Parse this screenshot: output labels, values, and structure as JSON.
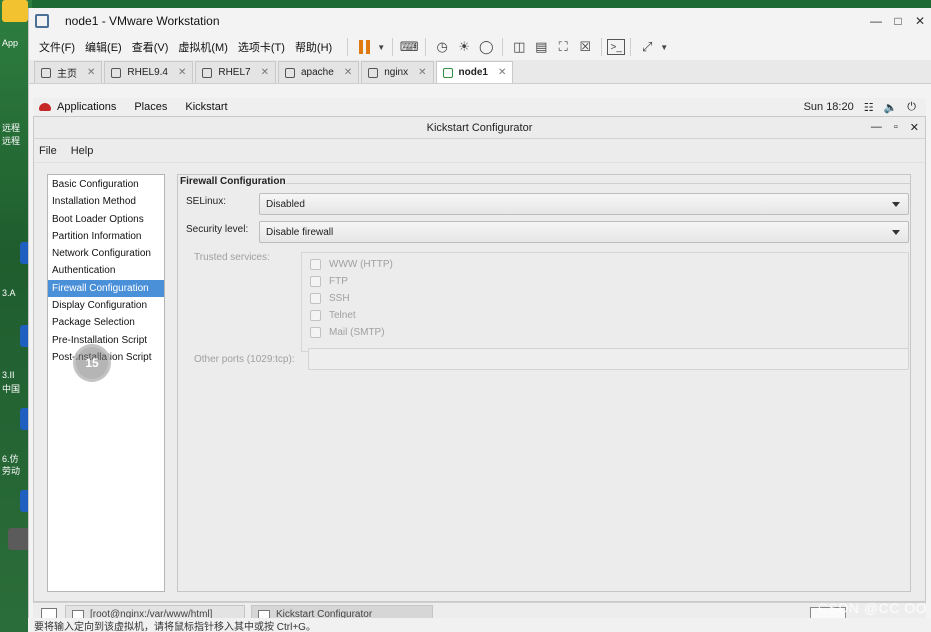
{
  "desktop": {
    "labels": [
      "App",
      "远程",
      "远程",
      "3.A",
      "3.II",
      "中国",
      "6.仿",
      "劳动"
    ]
  },
  "vmware": {
    "title": "node1 - VMware Workstation",
    "menu": [
      "文件(F)",
      "编辑(E)",
      "查看(V)",
      "虚拟机(M)",
      "选项卡(T)",
      "帮助(H)"
    ],
    "tabs": [
      {
        "label": "主页"
      },
      {
        "label": "RHEL9.4"
      },
      {
        "label": "RHEL7"
      },
      {
        "label": "apache"
      },
      {
        "label": "nginx"
      },
      {
        "label": "node1"
      }
    ],
    "status_text": "要将输入定向到该虚拟机，请将鼠标指针移入其中或按 Ctrl+G。"
  },
  "gnome": {
    "applications": "Applications",
    "places": "Places",
    "kickstart": "Kickstart",
    "clock": "Sun 18:20"
  },
  "kickstart": {
    "window_title": "Kickstart Configurator",
    "menu": [
      "File",
      "Help"
    ],
    "nav_items": [
      "Basic Configuration",
      "Installation Method",
      "Boot Loader Options",
      "Partition Information",
      "Network Configuration",
      "Authentication",
      "Firewall Configuration",
      "Display Configuration",
      "Package Selection",
      "Pre-Installation Script",
      "Post-Installation Script"
    ],
    "selected_nav": "Firewall Configuration",
    "panel_title": "Firewall Configuration",
    "selinux_label": "SELinux:",
    "selinux_value": "Disabled",
    "security_label": "Security level:",
    "security_value": "Disable firewall",
    "trusted_label": "Trusted services:",
    "trusted_services": [
      "WWW (HTTP)",
      "FTP",
      "SSH",
      "Telnet",
      "Mail (SMTP)"
    ],
    "other_ports_label": "Other ports (1029:tcp):",
    "other_ports_value": ""
  },
  "overlay": {
    "spot_number": "15"
  },
  "guest_taskbar": {
    "terminal_task": "[root@nginx:/var/www/html]",
    "kickstart_task": "Kickstart Configurator"
  },
  "watermark": "CSDN @CC OO"
}
